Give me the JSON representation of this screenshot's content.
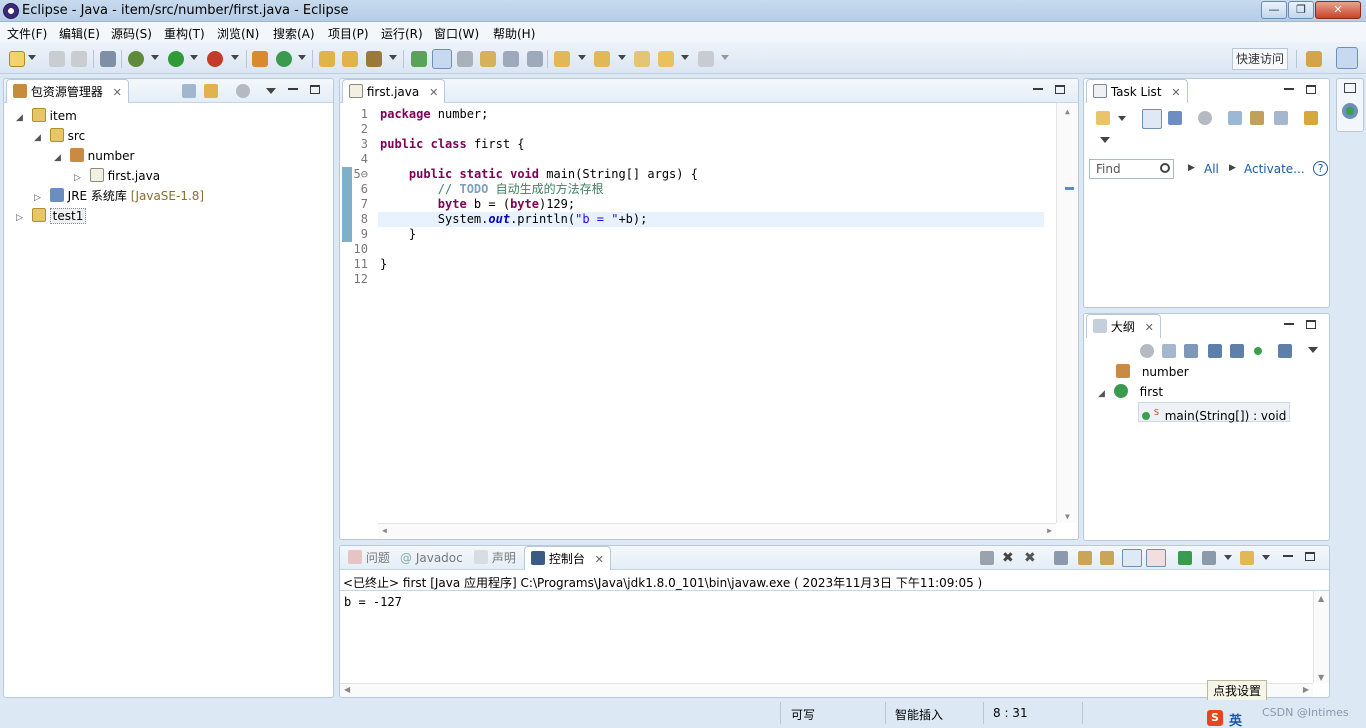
{
  "window": {
    "title": "Eclipse  -  Java  -  item/src/number/first.java  -  Eclipse",
    "minimize": "—",
    "restore": "❐",
    "close": "✕"
  },
  "menu": [
    "文件(F)",
    "编辑(E)",
    "源码(S)",
    "重构(T)",
    "浏览(N)",
    "搜索(A)",
    "项目(P)",
    "运行(R)",
    "窗口(W)",
    "帮助(H)"
  ],
  "toolbar": {
    "quick_access": "快速访问"
  },
  "package_explorer": {
    "tab_label": "包资源管理器",
    "tree": [
      {
        "label": "item",
        "twisty": "◢",
        "icon": "project-folder-icon"
      },
      {
        "label": "src",
        "twisty": "◢",
        "icon": "source-folder-icon"
      },
      {
        "label": "number",
        "twisty": "◢",
        "icon": "package-icon"
      },
      {
        "label": "first.java",
        "twisty": "▷",
        "icon": "java-file-icon"
      },
      {
        "label": "JRE 系统库",
        "version": "[JavaSE-1.8]",
        "twisty": "▷",
        "icon": "library-icon"
      },
      {
        "label": "test1",
        "twisty": "▷",
        "icon": "project-folder-icon"
      }
    ]
  },
  "editor": {
    "tab_label": "first.java",
    "line_numbers": [
      "1",
      "2",
      "3",
      "4",
      "5⊖",
      "6",
      "7",
      "8",
      "9",
      "10",
      "11",
      "12"
    ],
    "lines": [
      {
        "parts": [
          [
            "kw",
            "package"
          ],
          [
            "",
            " number;"
          ]
        ]
      },
      {
        "parts": []
      },
      {
        "parts": [
          [
            "kw",
            "public"
          ],
          [
            "",
            " "
          ],
          [
            "kw",
            "class"
          ],
          [
            "",
            " first {"
          ]
        ]
      },
      {
        "parts": []
      },
      {
        "parts": [
          [
            "",
            "    "
          ],
          [
            "kw",
            "public"
          ],
          [
            "",
            " "
          ],
          [
            "kw",
            "static"
          ],
          [
            "",
            " "
          ],
          [
            "kw",
            "void"
          ],
          [
            "",
            " main(String[] "
          ],
          [
            "",
            "args) {"
          ]
        ]
      },
      {
        "parts": [
          [
            "",
            "        "
          ],
          [
            "cm",
            "// "
          ],
          [
            "todo",
            "TODO"
          ],
          [
            "cm",
            " 自动生成的方法存根"
          ]
        ]
      },
      {
        "parts": [
          [
            "",
            "        "
          ],
          [
            "kw",
            "byte"
          ],
          [
            "",
            " b = ("
          ],
          [
            "kw",
            "byte"
          ],
          [
            "",
            ")129;"
          ]
        ]
      },
      {
        "parts": [
          [
            "",
            "        System."
          ],
          [
            "fld",
            "out"
          ],
          [
            "",
            ".println("
          ],
          [
            "st",
            "\"b = \""
          ],
          [
            "",
            "+b);"
          ]
        ]
      },
      {
        "parts": [
          [
            "",
            "    }"
          ]
        ]
      },
      {
        "parts": []
      },
      {
        "parts": [
          [
            "",
            "}"
          ]
        ]
      },
      {
        "parts": []
      }
    ]
  },
  "task_list": {
    "tab_label": "Task List",
    "find_placeholder": "Find",
    "all_label": "All",
    "activate_label": "Activate..."
  },
  "outline": {
    "tab_label": "大纲",
    "package": "number",
    "class": "first",
    "method": "main(String[]) : void",
    "method_modifier": "S"
  },
  "bottom": {
    "tabs": [
      "问题",
      "Javadoc",
      "声明",
      "控制台"
    ],
    "console_desc": "<已终止> first [Java 应用程序] C:\\Programs\\Java\\jdk1.8.0_101\\bin\\javaw.exe ( 2023年11月3日 下午11:09:05 )",
    "console_output": "b = -127"
  },
  "status": {
    "writable": "可写",
    "insert_mode": "智能插入",
    "position": "8 : 31",
    "tooltip": "点我设置",
    "ime_label": "英",
    "watermark": "CSDN @Intimes"
  },
  "colors": {
    "keyword": "#7f0055",
    "comment": "#3f7f5f",
    "string": "#2a00ff",
    "field": "#0000c0",
    "current_line": "#e8f2fe"
  }
}
